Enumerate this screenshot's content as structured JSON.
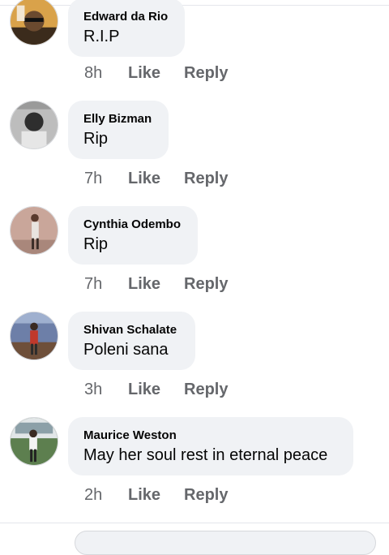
{
  "comments": [
    {
      "author": "Edward da Rio",
      "text": "R.I.P",
      "time": "8h",
      "like": "Like",
      "reply": "Reply"
    },
    {
      "author": "Elly Bizman",
      "text": "Rip",
      "time": "7h",
      "like": "Like",
      "reply": "Reply"
    },
    {
      "author": "Cynthia Odembo",
      "text": "Rip",
      "time": "7h",
      "like": "Like",
      "reply": "Reply"
    },
    {
      "author": "Shivan Schalate",
      "text": "Poleni sana",
      "time": "3h",
      "like": "Like",
      "reply": "Reply"
    },
    {
      "author": "Maurice Weston",
      "text": "May her soul rest in eternal peace",
      "time": "2h",
      "like": "Like",
      "reply": "Reply"
    }
  ],
  "colors": {
    "bubble": "#f0f2f5",
    "secondary_text": "#65676b",
    "primary_text": "#050505"
  }
}
